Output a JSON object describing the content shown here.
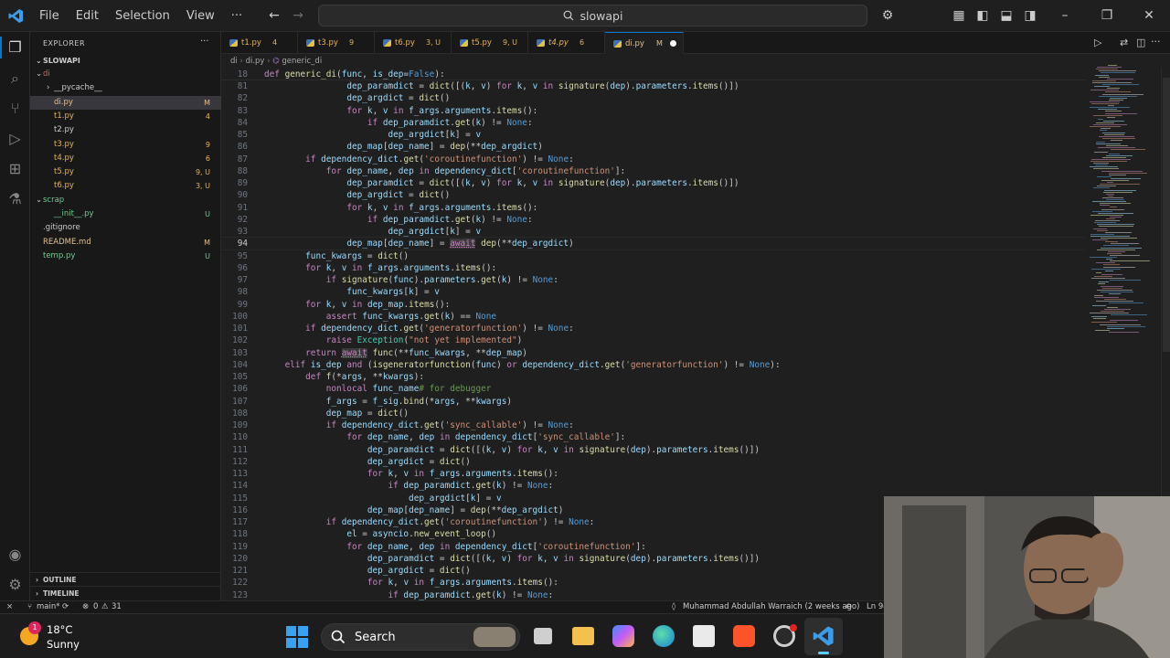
{
  "menu": {
    "file": "File",
    "edit": "Edit",
    "selection": "Selection",
    "view": "View",
    "more": "···"
  },
  "search": {
    "text": "slowapi"
  },
  "explorer": {
    "title": "EXPLORER",
    "more": "···",
    "root": "SLOWAPI",
    "items": [
      {
        "label": "di",
        "status": "",
        "color": "#cc6666",
        "indent": 14,
        "arrow": "⌄"
      },
      {
        "label": "__pycache__",
        "status": "",
        "color": "#cccccc",
        "indent": 26,
        "arrow": "›"
      },
      {
        "label": "di.py",
        "status": "M",
        "color": "#e2c08d",
        "indent": 26,
        "arrow": ""
      },
      {
        "label": "t1.py",
        "status": "4",
        "color": "#e6b45a",
        "indent": 26,
        "arrow": ""
      },
      {
        "label": "t2.py",
        "status": "",
        "color": "#cccccc",
        "indent": 26,
        "arrow": ""
      },
      {
        "label": "t3.py",
        "status": "9",
        "color": "#e6b45a",
        "indent": 26,
        "arrow": ""
      },
      {
        "label": "t4.py",
        "status": "6",
        "color": "#e6b45a",
        "indent": 26,
        "arrow": ""
      },
      {
        "label": "t5.py",
        "status": "9, U",
        "color": "#e6b45a",
        "indent": 26,
        "arrow": ""
      },
      {
        "label": "t6.py",
        "status": "3, U",
        "color": "#e6b45a",
        "indent": 26,
        "arrow": ""
      },
      {
        "label": "scrap",
        "status": "",
        "color": "#73c991",
        "indent": 14,
        "arrow": "⌄"
      },
      {
        "label": "__init__.py",
        "status": "U",
        "color": "#73c991",
        "indent": 26,
        "arrow": ""
      },
      {
        "label": ".gitignore",
        "status": "",
        "color": "#cccccc",
        "indent": 14,
        "arrow": ""
      },
      {
        "label": "README.md",
        "status": "M",
        "color": "#e2c08d",
        "indent": 14,
        "arrow": ""
      },
      {
        "label": "temp.py",
        "status": "U",
        "color": "#73c991",
        "indent": 14,
        "arrow": ""
      }
    ],
    "outline": "OUTLINE",
    "timeline": "TIMELINE"
  },
  "tabs": [
    {
      "name": "t1.py",
      "badge": "4",
      "italic": false,
      "color": "#e6b45a"
    },
    {
      "name": "t3.py",
      "badge": "9",
      "italic": false,
      "color": "#e6b45a"
    },
    {
      "name": "t6.py",
      "badge": "3, U",
      "italic": false,
      "color": "#e6b45a"
    },
    {
      "name": "t5.py",
      "badge": "9, U",
      "italic": false,
      "color": "#e6b45a"
    },
    {
      "name": "t4.py",
      "badge": "6",
      "italic": true,
      "color": "#e6b45a"
    },
    {
      "name": "di.py",
      "badge": "M",
      "italic": false,
      "color": "#e2c08d",
      "active": true
    }
  ],
  "breadcrumb": {
    "folder": "di",
    "file": "di.py",
    "symbol": "generic_di"
  },
  "code": {
    "sticky": {
      "line": "18",
      "text": "def generic_di(func, is_dep=False):"
    },
    "current_line": "94",
    "lines": [
      [
        "81",
        "                dep_paramdict = dict([(k, v) for k, v in signature(dep).parameters.items()])"
      ],
      [
        "82",
        "                dep_argdict = dict()"
      ],
      [
        "83",
        "                for k, v in f_args.arguments.items():"
      ],
      [
        "84",
        "                    if dep_paramdict.get(k) != None:"
      ],
      [
        "85",
        "                        dep_argdict[k] = v"
      ],
      [
        "86",
        "                dep_map[dep_name] = dep(**dep_argdict)"
      ],
      [
        "87",
        "        if dependency_dict.get('coroutinefunction') != None:"
      ],
      [
        "88",
        "            for dep_name, dep in dependency_dict['coroutinefunction']:"
      ],
      [
        "89",
        "                dep_paramdict = dict([(k, v) for k, v in signature(dep).parameters.items()])"
      ],
      [
        "90",
        "                dep_argdict = dict()"
      ],
      [
        "91",
        "                for k, v in f_args.arguments.items():"
      ],
      [
        "92",
        "                    if dep_paramdict.get(k) != None:"
      ],
      [
        "93",
        "                        dep_argdict[k] = v"
      ],
      [
        "94",
        "                dep_map[dep_name] = await dep(**dep_argdict)"
      ],
      [
        "95",
        "        func_kwargs = dict()"
      ],
      [
        "96",
        "        for k, v in f_args.arguments.items():"
      ],
      [
        "97",
        "            if signature(func).parameters.get(k) != None:"
      ],
      [
        "98",
        "                func_kwargs[k] = v"
      ],
      [
        "99",
        "        for k, v in dep_map.items():"
      ],
      [
        "100",
        "            assert func_kwargs.get(k) == None"
      ],
      [
        "101",
        "        if dependency_dict.get('generatorfunction') != None:"
      ],
      [
        "102",
        "            raise Exception(\"not yet implemented\")"
      ],
      [
        "103",
        "        return await func(**func_kwargs, **dep_map)"
      ],
      [
        "104",
        "    elif is_dep and (isgeneratorfunction(func) or dependency_dict.get('generatorfunction') != None):"
      ],
      [
        "105",
        "        def f(*args, **kwargs):"
      ],
      [
        "106",
        "            nonlocal func_name# for debugger"
      ],
      [
        "107",
        "            f_args = f_sig.bind(*args, **kwargs)"
      ],
      [
        "108",
        "            dep_map = dict()"
      ],
      [
        "109",
        "            if dependency_dict.get('sync_callable') != None:"
      ],
      [
        "110",
        "                for dep_name, dep in dependency_dict['sync_callable']:"
      ],
      [
        "111",
        "                    dep_paramdict = dict([(k, v) for k, v in signature(dep).parameters.items()])"
      ],
      [
        "112",
        "                    dep_argdict = dict()"
      ],
      [
        "113",
        "                    for k, v in f_args.arguments.items():"
      ],
      [
        "114",
        "                        if dep_paramdict.get(k) != None:"
      ],
      [
        "115",
        "                            dep_argdict[k] = v"
      ],
      [
        "116",
        "                    dep_map[dep_name] = dep(**dep_argdict)"
      ],
      [
        "117",
        "            if dependency_dict.get('coroutinefunction') != None:"
      ],
      [
        "118",
        "                el = asyncio.new_event_loop()"
      ],
      [
        "119",
        "                for dep_name, dep in dependency_dict['coroutinefunction']:"
      ],
      [
        "120",
        "                    dep_paramdict = dict([(k, v) for k, v in signature(dep).parameters.items()])"
      ],
      [
        "121",
        "                    dep_argdict = dict()"
      ],
      [
        "122",
        "                    for k, v in f_args.arguments.items():"
      ],
      [
        "123",
        "                        if dep_paramdict.get(k) != None:"
      ]
    ]
  },
  "status": {
    "branch": "main*",
    "errors": "0",
    "warnings": "31",
    "blame": "Muhammad Abdullah Warraich (2 weeks ago)",
    "position": "Ln 94"
  },
  "taskbar": {
    "temperature": "18°C",
    "weather": "Sunny",
    "weather_badge": "1",
    "search": "Search"
  }
}
